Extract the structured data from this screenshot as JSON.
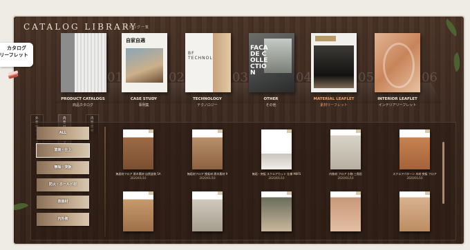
{
  "header": {
    "title": "CATALOG LIBRARY",
    "subtitle": "カタログ一覧"
  },
  "side_tab": {
    "line1": "カタログ",
    "line2": "リーフレット"
  },
  "categories": [
    {
      "name": "PRODUCT CATALOGS",
      "jp": "商品カタログ",
      "num": "01",
      "active": false
    },
    {
      "name": "CASE STUDY",
      "jp": "事例集",
      "num": "02",
      "active": false
    },
    {
      "name": "TECHNOLOGY",
      "jp": "テクノロジー",
      "num": "03",
      "active": false
    },
    {
      "name": "OTHER",
      "jp": "その他",
      "num": "04",
      "active": false
    },
    {
      "name": "MATERIAL LEAFLET",
      "jp": "素材リーフレット",
      "num": "05",
      "active": true
    },
    {
      "name": "INTERIOR LEAFLET",
      "jp": "インテリアリーフレット",
      "num": "06",
      "active": false
    }
  ],
  "book_covers": {
    "case_study": "自家自適",
    "technology": "BF TECHNOLOGY",
    "other": "FACADE COLLECTION"
  },
  "tabs": [
    "外装材シリーズ",
    "内装材シリーズ",
    "内装建材"
  ],
  "menu": [
    "ALL",
    "塗装・仕上",
    "無垢・突板",
    "防火・ホールド材",
    "表装材",
    "内外装"
  ],
  "products": [
    {
      "name": "無垢材フロア 原木素材 自然塗装 5A",
      "date": "2020/01/10"
    },
    {
      "name": "無垢材フロア 挽板材 原木素材 9",
      "date": "2020/01/10"
    },
    {
      "name": "無垢・突板 スクエアカット 仕様 M8FS",
      "date": "2020/01/10"
    },
    {
      "name": "内装材 フロア 小物 三角形",
      "date": "2020/01/10"
    },
    {
      "name": "スクエアパターン 木材 突板 フロア",
      "date": "2020/01/10"
    }
  ],
  "colors": {
    "accent": "#f2a06a",
    "wood_dark": "#3d2a20",
    "label": "#f0e6d8"
  }
}
